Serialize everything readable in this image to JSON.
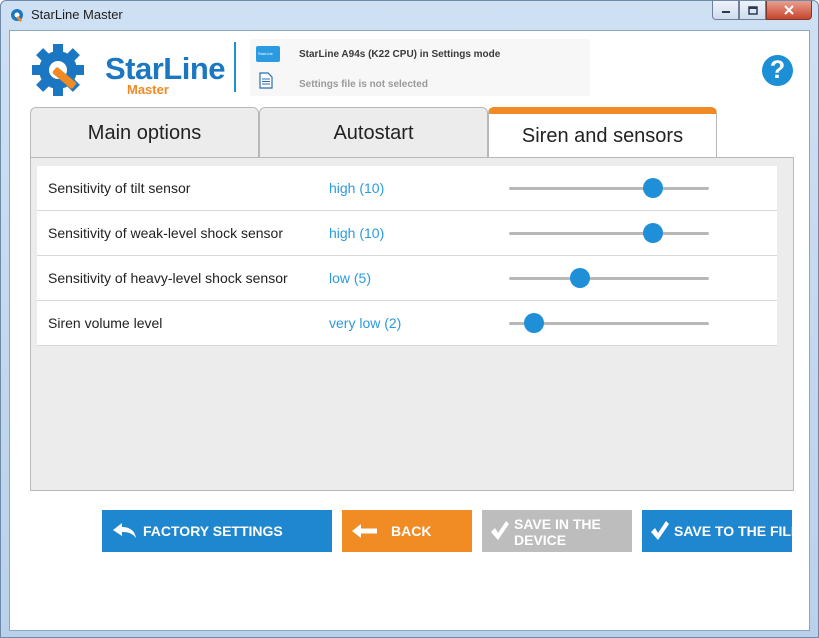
{
  "window": {
    "title": "StarLine Master",
    "icon": "gear-wrench-icon"
  },
  "header": {
    "logo_text": "StarLine",
    "logo_sub": "Master",
    "device_icon_text": "StarLine",
    "status_line1": "StarLine A94s (K22 CPU) in Settings mode",
    "status_line2": "Settings file is not selected",
    "help_label": "?"
  },
  "tabs": [
    {
      "label": "Main options",
      "active": false
    },
    {
      "label": "Autostart",
      "active": false
    },
    {
      "label": "Siren and sensors",
      "active": true
    }
  ],
  "settings": [
    {
      "label": "Sensitivity of tilt sensor",
      "value": "high (10)",
      "level": 0.72
    },
    {
      "label": "Sensitivity of weak-level shock sensor",
      "value": "high (10)",
      "level": 0.72
    },
    {
      "label": "Sensitivity of heavy-level shock sensor",
      "value": "low (5)",
      "level": 0.355
    },
    {
      "label": "Siren volume level",
      "value": "very low (2)",
      "level": 0.125
    }
  ],
  "buttons": {
    "factory": "FACTORY SETTINGS",
    "back": "BACK",
    "save_device_1": "SAVE IN THE",
    "save_device_2": "DEVICE",
    "save_file": "SAVE TO THE FILE"
  },
  "colors": {
    "accent_blue": "#1e87cf",
    "accent_orange": "#f18b24",
    "disabled_gray": "#bdbdbd",
    "value_blue": "#2a9be0"
  }
}
